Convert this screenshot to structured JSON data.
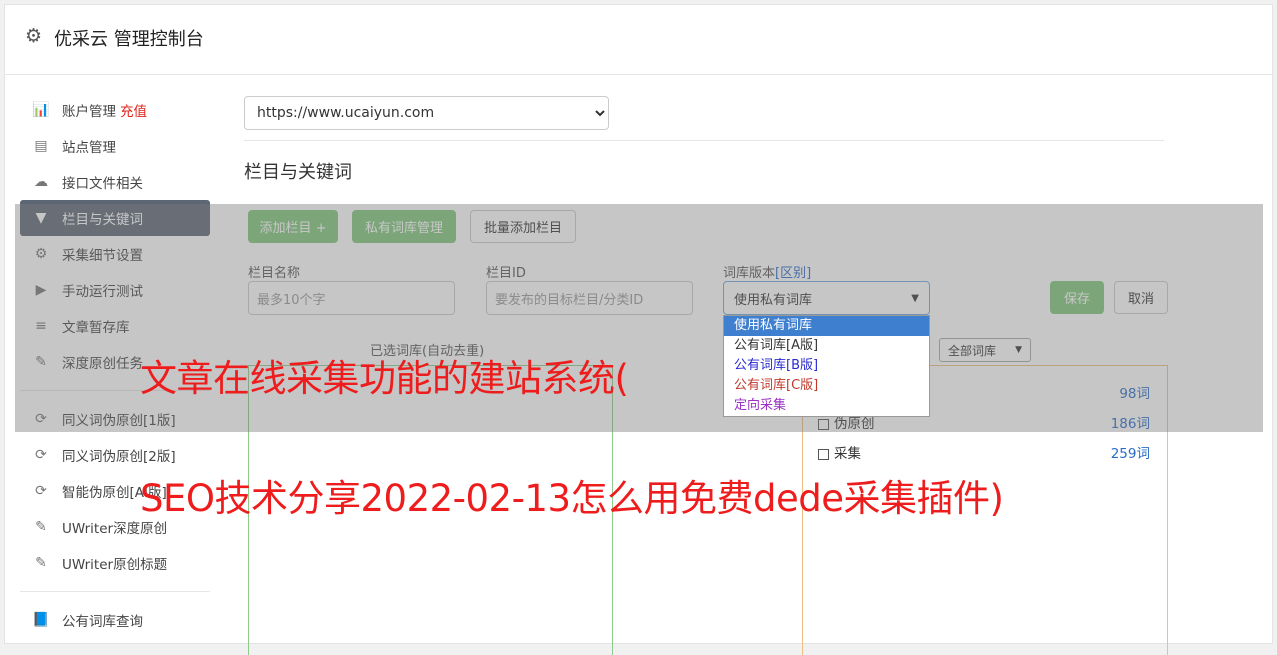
{
  "header": {
    "title": "优采云 管理控制台",
    "icon": "gear-icon"
  },
  "sidebar": {
    "items": [
      {
        "label": "账户管理",
        "badge": "充值",
        "icon": "bar-chart-icon"
      },
      {
        "label": "站点管理",
        "icon": "server-icon"
      },
      {
        "label": "接口文件相关",
        "icon": "cloud-upload-icon"
      },
      {
        "label": "栏目与关键词",
        "icon": "filter-icon",
        "active": true
      },
      {
        "label": "采集细节设置",
        "icon": "cogs-icon"
      },
      {
        "label": "手动运行测试",
        "icon": "play-circle-icon"
      },
      {
        "label": "文章暂存库",
        "icon": "database-icon"
      },
      {
        "label": "深度原创任务",
        "icon": "edit-icon"
      },
      {
        "label": "同义词伪原创[1版]",
        "icon": "refresh-icon"
      },
      {
        "label": "同义词伪原创[2版]",
        "icon": "refresh-icon"
      },
      {
        "label": "智能伪原创[AI版]",
        "icon": "refresh-icon"
      },
      {
        "label": "UWriter深度原创",
        "icon": "edit-icon"
      },
      {
        "label": "UWriter原创标题",
        "icon": "edit-icon"
      },
      {
        "label": "公有词库查询",
        "icon": "book-icon"
      }
    ]
  },
  "main": {
    "site_select": "https://www.ucaiyun.com",
    "section_title": "栏目与关键词",
    "buttons": {
      "add_column": "添加栏目 +",
      "private_lib": "私有词库管理",
      "batch_add": "批量添加栏目",
      "save": "保存",
      "cancel": "取消"
    },
    "form": {
      "name_label": "栏目名称",
      "name_placeholder": "最多10个字",
      "id_label": "栏目ID",
      "id_placeholder": "要发布的目标栏目/分类ID",
      "lib_label": "词库版本",
      "lib_label_link": "[区别]",
      "lib_value": "使用私有词库"
    },
    "lib_options": [
      "使用私有词库",
      "公有词库[A版]",
      "公有词库[B版]",
      "公有词库[C版]",
      "定向采集"
    ],
    "selected_caption": "已选词库(自动去重)",
    "filter_select": "全部词库",
    "libraries": [
      {
        "name": "",
        "count": "98词"
      },
      {
        "name": "伪原创",
        "count": "186词"
      },
      {
        "name": "采集",
        "count": "259词"
      }
    ]
  },
  "watermark": {
    "line1": "文章在线采集功能的建站系统(",
    "line2": "SEO技术分享2022-02-13怎么用免费dede采集插件)",
    "color": "#ee1c1c"
  }
}
